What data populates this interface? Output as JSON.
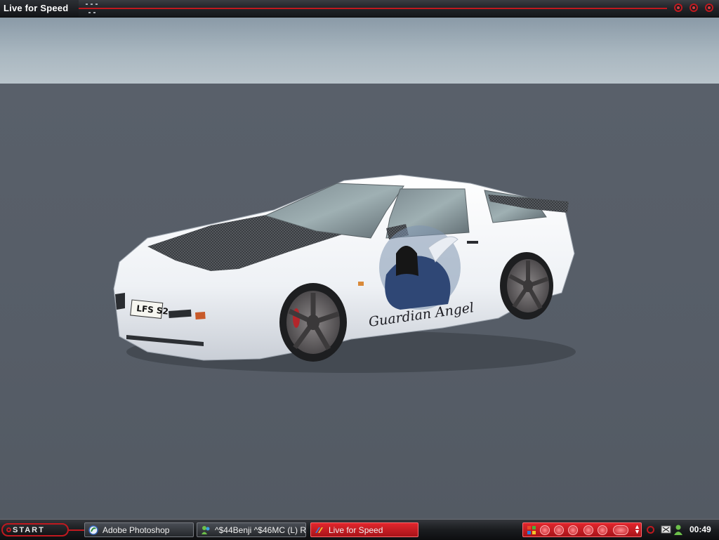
{
  "window": {
    "title": "Live for Speed"
  },
  "scene": {
    "plate_text": "LFS S2",
    "livery_text": "Guardian Angel"
  },
  "taskbar": {
    "start_label": "START",
    "tasks": [
      {
        "label": "Adobe Photoshop",
        "icon": "photoshop-icon",
        "active": false
      },
      {
        "label": "^$44Benji ^$46MC (L) R ...",
        "icon": "messenger-icon",
        "active": false
      },
      {
        "label": "Live for Speed",
        "icon": "lfs-icon",
        "active": true
      }
    ],
    "clock": "00:49"
  },
  "colors": {
    "accent_red": "#c0191f",
    "ground": "#565d67",
    "sky": "#a9b7c0",
    "car_body": "#f2f4f7"
  }
}
